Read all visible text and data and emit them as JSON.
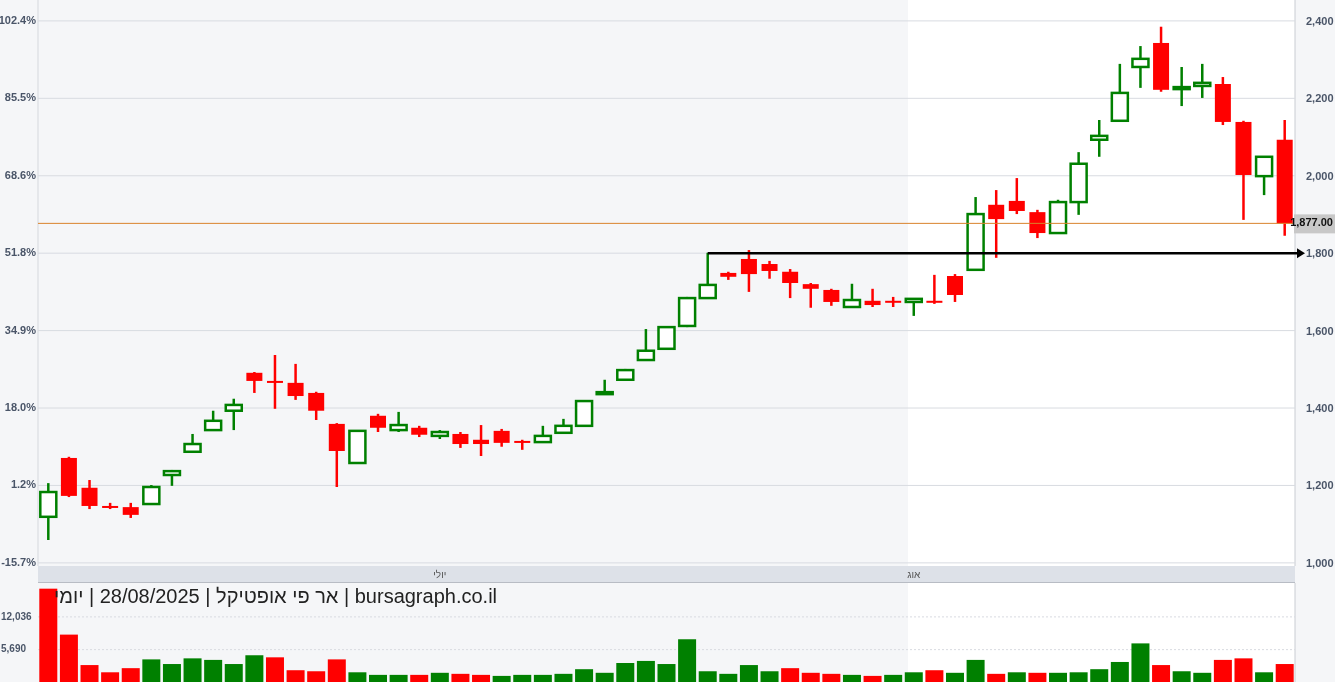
{
  "price_chart": {
    "percent_labels": [
      "102.4%",
      "85.5%",
      "68.6%",
      "51.8%",
      "34.9%",
      "18.0%",
      "1.2%",
      "-15.7%"
    ],
    "chart_data": {
      "type": "candlestick",
      "grid": true,
      "ylim": [
        948,
        2454
      ],
      "yticks": [
        {
          "value": 2400,
          "label": "2,400"
        },
        {
          "value": 2200,
          "label": "2,200"
        },
        {
          "value": 2000,
          "label": "2,000"
        },
        {
          "value": 1800,
          "label": "1,800"
        },
        {
          "value": 1600,
          "label": "1,600"
        },
        {
          "value": 1400,
          "label": "1,400"
        },
        {
          "value": 1200,
          "label": "1,200"
        },
        {
          "value": 1000,
          "label": "1,000"
        }
      ],
      "categories": [
        null,
        null,
        null,
        null,
        null,
        null,
        null,
        null,
        null,
        null,
        null,
        null,
        null,
        null,
        null,
        null,
        null,
        null,
        null,
        "יולי",
        null,
        null,
        null,
        null,
        null,
        null,
        null,
        null,
        null,
        null,
        null,
        null,
        null,
        null,
        null,
        null,
        null,
        null,
        null,
        null,
        null,
        null,
        "אוג",
        null,
        null,
        null,
        null,
        null,
        null,
        null,
        null,
        null,
        null,
        null,
        null,
        null,
        null,
        null,
        null,
        null,
        null
      ],
      "ohlc": [
        [
          1119,
          1206,
          1059,
          1183
        ],
        [
          1271,
          1274,
          1170,
          1173
        ],
        [
          1194,
          1214,
          1139,
          1147
        ],
        [
          1147,
          1155,
          1139,
          1142
        ],
        [
          1144,
          1155,
          1116,
          1124
        ],
        [
          1152,
          1201,
          1150,
          1196
        ],
        [
          1227,
          1240,
          1199,
          1237
        ],
        [
          1287,
          1333,
          1284,
          1307
        ],
        [
          1343,
          1393,
          1341,
          1367
        ],
        [
          1393,
          1424,
          1343,
          1408
        ],
        [
          1491,
          1493,
          1439,
          1470
        ],
        [
          1470,
          1537,
          1398,
          1465
        ],
        [
          1465,
          1514,
          1421,
          1431
        ],
        [
          1439,
          1442,
          1369,
          1393
        ],
        [
          1359,
          1361,
          1196,
          1289
        ],
        [
          1258,
          1341,
          1258,
          1341
        ],
        [
          1380,
          1385,
          1338,
          1349
        ],
        [
          1343,
          1390,
          1338,
          1356
        ],
        [
          1349,
          1354,
          1325,
          1331
        ],
        [
          1328,
          1343,
          1320,
          1338
        ],
        [
          1333,
          1338,
          1297,
          1307
        ],
        [
          1318,
          1356,
          1276,
          1307
        ],
        [
          1341,
          1346,
          1300,
          1310
        ],
        [
          1315,
          1318,
          1292,
          1312
        ],
        [
          1312,
          1354,
          1310,
          1328
        ],
        [
          1336,
          1372,
          1333,
          1354
        ],
        [
          1354,
          1418,
          1354,
          1418
        ],
        [
          1436,
          1473,
          1434,
          1441
        ],
        [
          1473,
          1501,
          1470,
          1498
        ],
        [
          1524,
          1604,
          1522,
          1548
        ],
        [
          1553,
          1609,
          1553,
          1609
        ],
        [
          1612,
          1687,
          1609,
          1684
        ],
        [
          1684,
          1801,
          1682,
          1718
        ],
        [
          1749,
          1752,
          1731,
          1739
        ],
        [
          1785,
          1808,
          1700,
          1746
        ],
        [
          1772,
          1780,
          1734,
          1754
        ],
        [
          1752,
          1759,
          1684,
          1723
        ],
        [
          1720,
          1723,
          1659,
          1708
        ],
        [
          1705,
          1708,
          1664,
          1674
        ],
        [
          1661,
          1721,
          1659,
          1679
        ],
        [
          1677,
          1708,
          1661,
          1666
        ],
        [
          1677,
          1687,
          1661,
          1672
        ],
        [
          1674,
          1684,
          1638,
          1682
        ],
        [
          1677,
          1744,
          1669,
          1674
        ],
        [
          1741,
          1746,
          1674,
          1692
        ],
        [
          1757,
          1945,
          1754,
          1901
        ],
        [
          1925,
          1963,
          1788,
          1888
        ],
        [
          1935,
          1994,
          1901,
          1909
        ],
        [
          1906,
          1912,
          1839,
          1852
        ],
        [
          1852,
          1938,
          1850,
          1932
        ],
        [
          1932,
          2061,
          1899,
          2031
        ],
        [
          2093,
          2144,
          2049,
          2103
        ],
        [
          2142,
          2289,
          2139,
          2214
        ],
        [
          2281,
          2335,
          2227,
          2302
        ],
        [
          2343,
          2385,
          2217,
          2222
        ],
        [
          2224,
          2281,
          2180,
          2229
        ],
        [
          2232,
          2289,
          2201,
          2240
        ],
        [
          2237,
          2255,
          2131,
          2139
        ],
        [
          2139,
          2142,
          1886,
          2002
        ],
        [
          1999,
          2051,
          1950,
          2049
        ],
        [
          2093,
          2144,
          1845,
          1877
        ]
      ],
      "ref_lines": [
        {
          "axis": "y",
          "value": 1877,
          "label": "1,877.00",
          "color": "#d9822b"
        },
        {
          "axis": "y",
          "value": 1800,
          "color": "#000000"
        }
      ]
    }
  },
  "volume_chart": {
    "title": "bursagraph.co.il | אר פי אופטיקל | 28/08/2025 | יומי",
    "chart_data": {
      "type": "bar",
      "stacked": true,
      "ylim": [
        0,
        18600
      ],
      "grid": true,
      "yticks": [
        {
          "value": 12036,
          "label": "12,036"
        },
        {
          "value": 5690,
          "label": "5,690"
        }
      ],
      "series": [
        {
          "color": "#008000",
          "values": [
            null,
            null,
            null,
            null,
            null,
            3800,
            2900,
            4000,
            3700,
            2900,
            4600,
            null,
            null,
            null,
            null,
            1300,
            800,
            800,
            null,
            1200,
            null,
            null,
            600,
            800,
            800,
            1000,
            1900,
            1200,
            3100,
            3500,
            2900,
            7700,
            1500,
            1000,
            2700,
            1500,
            null,
            null,
            null,
            800,
            null,
            800,
            1300,
            null,
            1200,
            3700,
            null,
            1300,
            null,
            1200,
            1300,
            1900,
            3300,
            6900,
            null,
            1500,
            1200,
            null,
            null,
            1300,
            null
          ]
        },
        {
          "color": "#ff0000",
          "values": [
            17500,
            8600,
            2700,
            1300,
            2100,
            null,
            null,
            null,
            null,
            null,
            null,
            4200,
            1700,
            1500,
            3800,
            null,
            null,
            null,
            800,
            null,
            1000,
            800,
            null,
            null,
            null,
            null,
            null,
            null,
            null,
            null,
            null,
            null,
            null,
            null,
            null,
            null,
            2100,
            1200,
            1000,
            null,
            600,
            null,
            null,
            1700,
            null,
            null,
            1000,
            null,
            1200,
            null,
            null,
            null,
            null,
            null,
            2700,
            null,
            null,
            3700,
            4000,
            null,
            2900
          ]
        }
      ]
    }
  }
}
